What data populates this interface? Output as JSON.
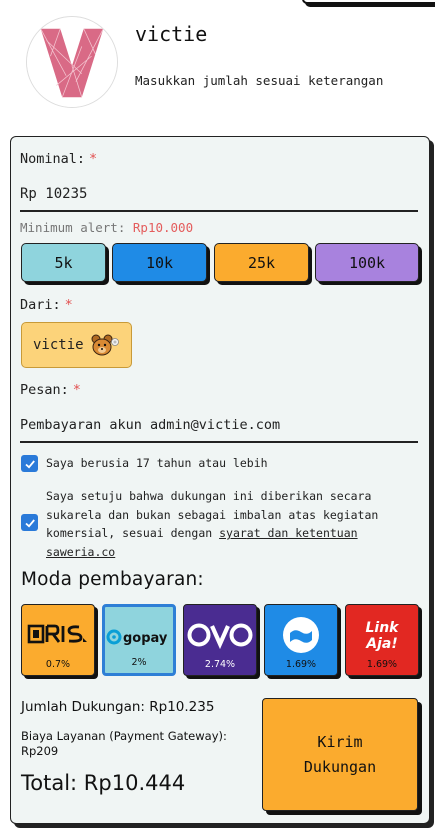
{
  "creator": {
    "name": "victie",
    "subtitle": "Masukkan jumlah sesuai keterangan"
  },
  "form": {
    "nominal_label": "Nominal:",
    "nominal_value": "Rp 10235",
    "required_mark": "*",
    "minimum_label": "Minimum alert:",
    "minimum_value": "Rp10.000",
    "presets": [
      {
        "label": "5k",
        "color": "#8fd4dd"
      },
      {
        "label": "10k",
        "color": "#1f8be6"
      },
      {
        "label": "25k",
        "color": "#fbab2e"
      },
      {
        "label": "100k",
        "color": "#a882de"
      }
    ],
    "from_label": "Dari:",
    "from_value": "victie",
    "message_label": "Pesan:",
    "message_value": "Pembayaran akun admin@victie.com",
    "age_check": {
      "checked": true,
      "text": "Saya berusia 17 tahun atau lebih"
    },
    "consent_check": {
      "checked": true,
      "line1": "Saya setuju bahwa dukungan ini diberikan secara",
      "line2": "sukarela dan bukan sebagai imbalan atas kegiatan",
      "line3_prefix": "komersial, sesuai dengan ",
      "tos_part1": "syarat dan ketentuan",
      "tos_part2": "saweria.co"
    }
  },
  "payment": {
    "title": "Moda pembayaran:",
    "methods": [
      {
        "name": "QRIS",
        "fee": "0.7%",
        "color": "#fbab2e",
        "selected": false
      },
      {
        "name": "gopay",
        "fee": "2%",
        "color": "#8fd4dd",
        "selected": true
      },
      {
        "name": "OVO",
        "fee": "2.74%",
        "color": "#4a2c91",
        "selected": false
      },
      {
        "name": "DANA",
        "fee": "1.69%",
        "color": "#1f8be6",
        "selected": false
      },
      {
        "name": "LinkAja!",
        "fee": "1.69%",
        "color": "#e22822",
        "selected": false
      }
    ]
  },
  "summary": {
    "jumlah": "Jumlah Dukungan: Rp10.235",
    "biaya_line1": "Biaya Layanan (Payment Gateway):",
    "biaya_line2": "Rp209",
    "total": "Total: Rp10.444"
  },
  "submit": {
    "line1": "Kirim",
    "line2": "Dukungan"
  }
}
